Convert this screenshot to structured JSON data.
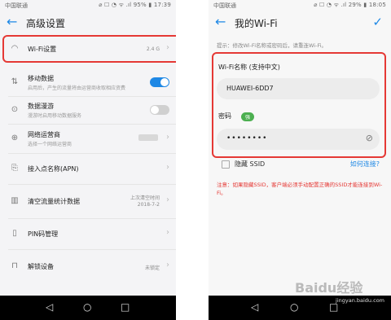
{
  "left": {
    "status": {
      "carrier": "中国联通",
      "right": "⌀ ☐ ◔ ᯤ .ıl 95% ▮ 17:39"
    },
    "title": "高级设置",
    "rows": [
      {
        "title": "Wi-Fi设置",
        "value": "2.4 G"
      },
      {
        "title": "移动数据",
        "sub": "启用后，产生的流量将由运营商收取相应资费"
      },
      {
        "title": "数据漫游",
        "sub": "漫游时启用移动数据服务"
      },
      {
        "title": "网络运营商",
        "sub": "选择一个网络运营商"
      },
      {
        "title": "接入点名称(APN)"
      },
      {
        "title": "清空流量统计数据",
        "value1": "上次清空时间",
        "value2": "2018-7-2"
      },
      {
        "title": "PIN码管理"
      },
      {
        "title": "解锁设备",
        "value": "未锁定"
      }
    ]
  },
  "right": {
    "status": {
      "carrier": "中国联通",
      "right": "⌀ ☐ ◔ ᯤ .ıl 29% ▮ 18:05"
    },
    "title": "我的Wi-Fi",
    "hint": "提示：修改Wi-Fi名称或密码后，请重连Wi-Fi。",
    "name_label": "Wi-Fi名称 (支持中文)",
    "name_value": "HUAWEI-6DD7",
    "pwd_label": "密码",
    "pwd_strength": "强",
    "pwd_value": "••••••••",
    "hide_ssid": "隐藏 SSID",
    "how_connect": "如何连接?",
    "warning": "注意：如果隐藏SSID，客户端必须手动配置正确的SSID才能连接到Wi-Fi。"
  },
  "watermark": "Baidu经验",
  "watermark_url": "jingyan.baidu.com",
  "colors": {
    "accent": "#1e88e5",
    "highlight": "#e53935",
    "warning": "#e53935"
  }
}
